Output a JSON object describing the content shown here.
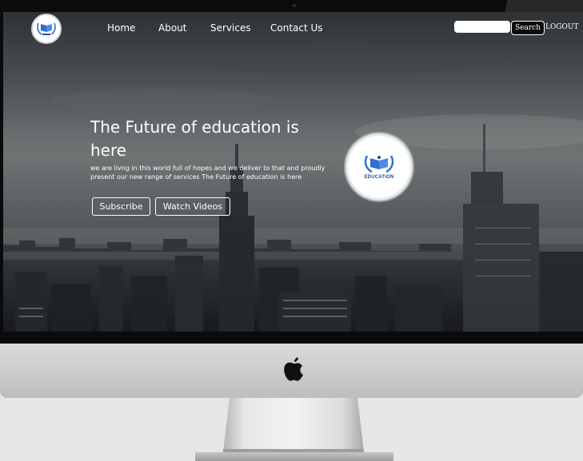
{
  "nav": {
    "links": [
      "Home",
      "About",
      "Services",
      "Contact Us"
    ],
    "search_placeholder": "",
    "search_label": "Search",
    "logout_label": "LOGOUT"
  },
  "hero": {
    "title": "The Future of education is here",
    "description": "we are livng in this world full of hopes and we deliver to that and proudly present our new range of services The Future of education is here",
    "buttons": [
      "Subscribe",
      "Watch Videos"
    ],
    "logo_text": "EDUCATION"
  },
  "colors": {
    "accent": "#1f4e9c",
    "logo_blue": "#2f6fd0"
  },
  "icons": {
    "brand": "apple-logo-icon",
    "logo": "open-book-laurel-icon"
  }
}
